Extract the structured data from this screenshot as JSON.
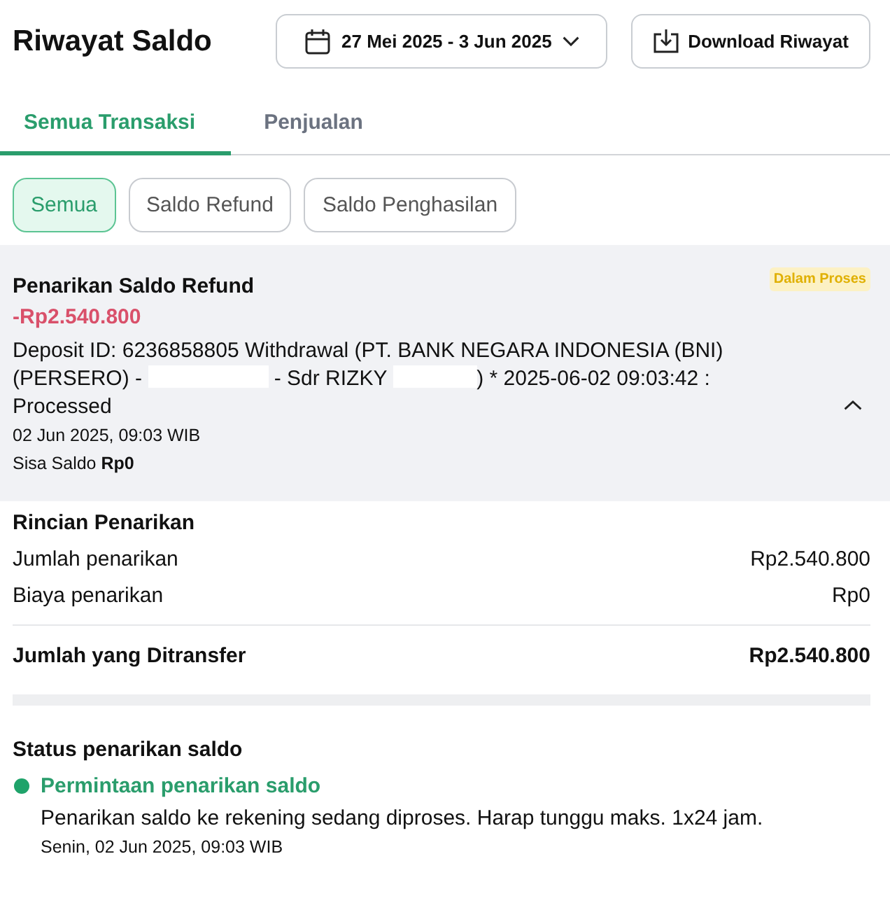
{
  "header": {
    "title": "Riwayat Saldo",
    "date_range": {
      "label": "27 Mei 2025 - 3 Jun 2025"
    },
    "download_button": {
      "label": "Download Riwayat"
    }
  },
  "tabs": [
    {
      "label": "Semua Transaksi",
      "selected": true
    },
    {
      "label": "Penjualan",
      "selected": false
    }
  ],
  "filters": [
    {
      "label": "Semua",
      "selected": true
    },
    {
      "label": "Saldo Refund",
      "selected": false
    },
    {
      "label": "Saldo Penghasilan",
      "selected": false
    }
  ],
  "transaction": {
    "title": "Penarikan Saldo Refund",
    "amount": "-Rp2.540.800",
    "status_badge": "Dalam Proses",
    "description": [
      {
        "kind": "text",
        "text": "Deposit ID: 6236858805 Withdrawal (PT. BANK NEGARA INDONESIA (BNI) (PERSERO) - "
      },
      {
        "kind": "redacted"
      },
      {
        "kind": "text",
        "text": " - Sdr RIZKY "
      },
      {
        "kind": "redacted"
      },
      {
        "kind": "text",
        "text": ") * 2025-06-02 09:03:42 : Processed"
      }
    ],
    "date": "02 Jun 2025, 09:03 WIB",
    "balance": "Sisa Saldo **Rp0**",
    "expanded": true
  },
  "details": {
    "title": "Rincian Penarikan",
    "rows": [
      {
        "kind": "normal",
        "label": "Jumlah penarikan",
        "value": "Rp2.540.800"
      },
      {
        "kind": "normal",
        "label": "Biaya penarikan",
        "value": "Rp0"
      },
      {
        "kind": "total",
        "label": "Jumlah yang Ditransfer",
        "value": "Rp2.540.800"
      }
    ]
  },
  "status": {
    "title": "Status penarikan saldo",
    "steps": [
      {
        "title": "Permintaan penarikan saldo",
        "description": "Penarikan saldo ke rekening sedang diproses. Harap tunggu maks. 1x24 jam.",
        "time": "Senin, 02 Jun 2025, 09:03 WIB"
      }
    ]
  }
}
